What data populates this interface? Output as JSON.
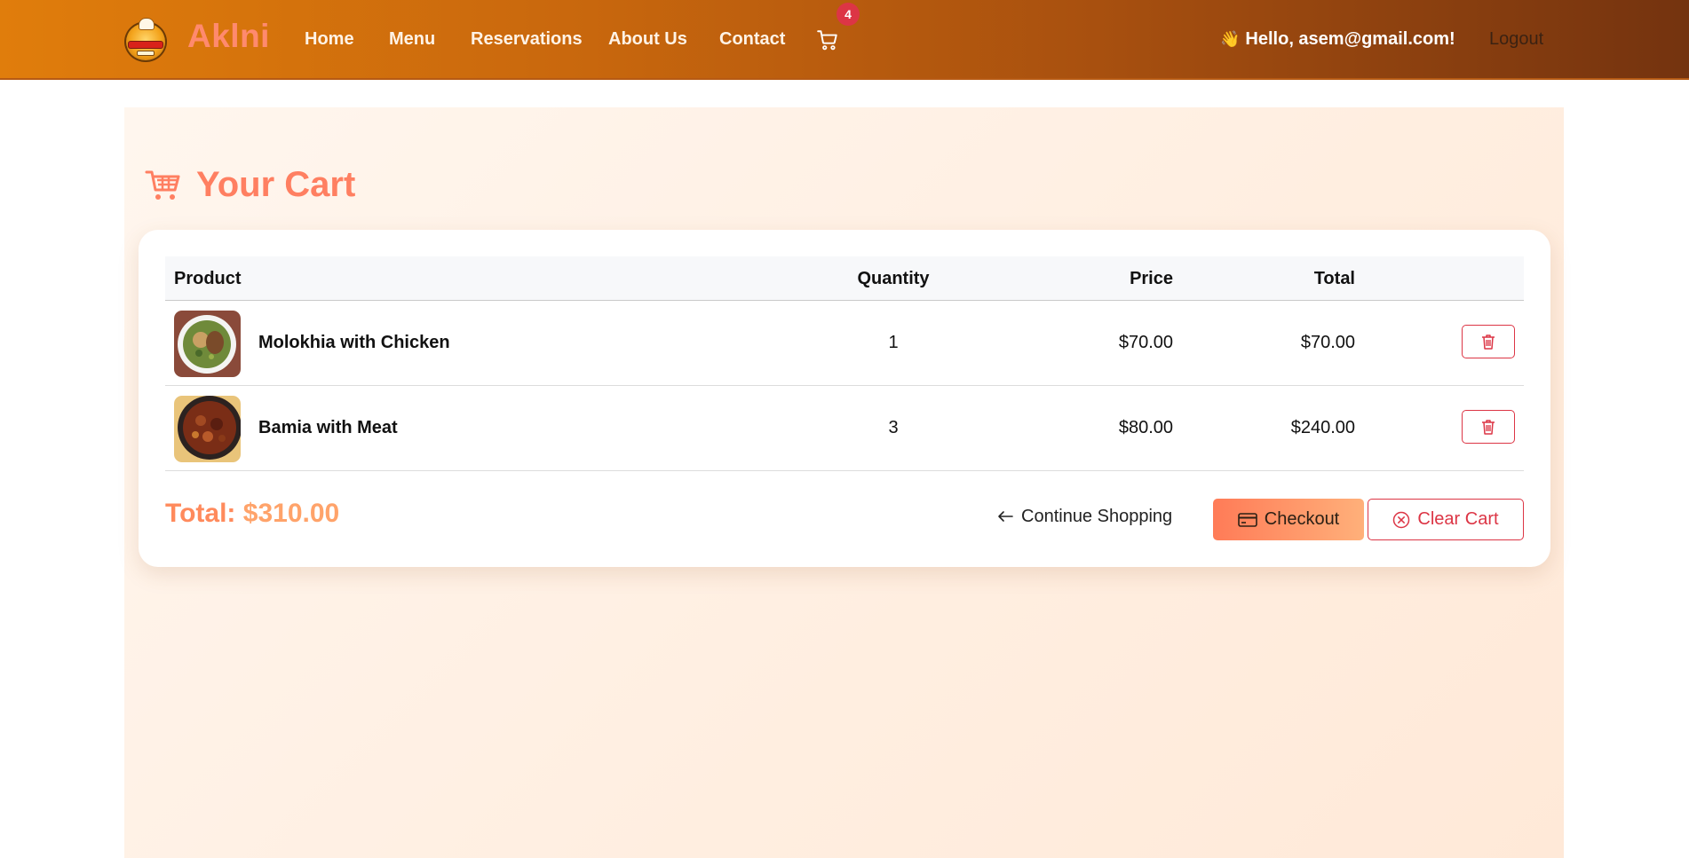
{
  "navbar": {
    "brand": "Aklni",
    "links": [
      "Home",
      "Menu",
      "Reservations",
      "About Us",
      "Contact"
    ],
    "cart_count": "4",
    "greeting": "Hello, asem@gmail.com!",
    "logout": "Logout",
    "icons": {
      "logo": "restaurant-logo-icon",
      "cart": "shopping-cart-icon",
      "wave": "waving-hand-icon"
    }
  },
  "page": {
    "title": "Your Cart",
    "title_icon": "shopping-cart-icon"
  },
  "cart": {
    "headers": {
      "product": "Product",
      "quantity": "Quantity",
      "price": "Price",
      "total": "Total"
    },
    "items": [
      {
        "name": "Molokhia with Chicken",
        "quantity": "1",
        "price": "$70.00",
        "total": "$70.00",
        "image": "molokhia-dish-image"
      },
      {
        "name": "Bamia with Meat",
        "quantity": "3",
        "price": "$80.00",
        "total": "$240.00",
        "image": "bamia-dish-image"
      }
    ],
    "grand_total_label": "Total:",
    "grand_total_value": "$310.00",
    "continue_label": "Continue Shopping",
    "checkout_label": "Checkout",
    "clear_label": "Clear Cart"
  },
  "colors": {
    "accent": "#ff7f61",
    "danger": "#dc3545",
    "badge": "#dc3545",
    "navbar_start": "#e07d0c",
    "navbar_end": "#74330f"
  }
}
